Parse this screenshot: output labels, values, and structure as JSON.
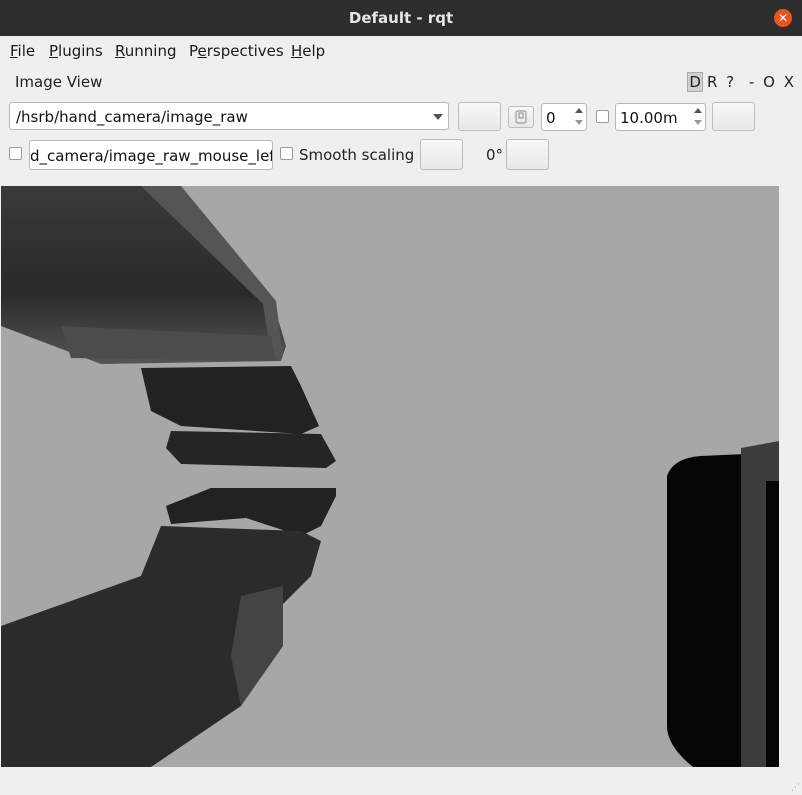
{
  "window": {
    "title": "Default - rqt",
    "close_icon": "close-icon"
  },
  "menubar": {
    "items": [
      {
        "label": "File",
        "mnemonic": "F"
      },
      {
        "label": "Plugins",
        "mnemonic": "P"
      },
      {
        "label": "Running",
        "mnemonic": "R"
      },
      {
        "label": "Perspectives",
        "mnemonic": "e"
      },
      {
        "label": "Help",
        "mnemonic": "H"
      }
    ]
  },
  "plugin": {
    "title": "Image View",
    "controls": {
      "d": "D",
      "r": "R",
      "help": "?",
      "minimize": "-",
      "float": "O",
      "close": "X"
    }
  },
  "toolbar": {
    "topic": "/hsrb/hand_camera/image_raw",
    "spin_value": "0",
    "duration": "10.00m",
    "mouse_topic": "d_camera/image_raw_mouse_left",
    "smooth_scaling_label": "Smooth scaling",
    "rotation": "0°"
  }
}
